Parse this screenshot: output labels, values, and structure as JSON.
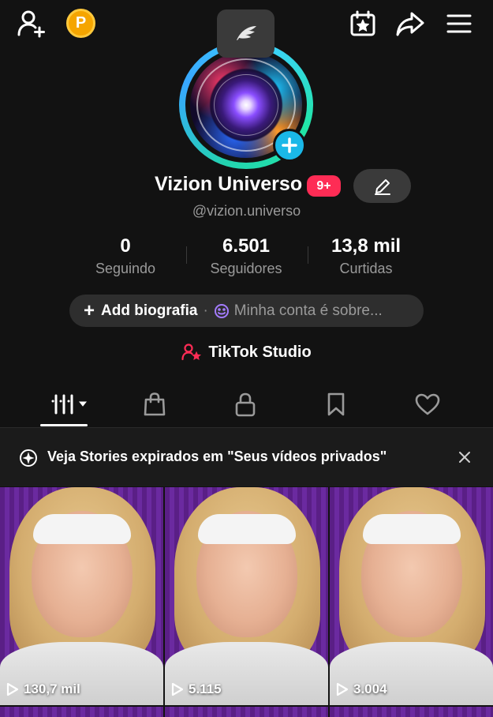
{
  "topbar": {
    "left_icons": [
      "add-friend-icon",
      "coin-icon"
    ],
    "coin_label": "P",
    "right_icons": [
      "calendar-star-icon",
      "share-icon",
      "menu-icon"
    ]
  },
  "profile": {
    "display_name": "Vizion Universo",
    "notification_badge": "9+",
    "username": "@vizion.universo",
    "avatar_theme": "zodiac-wheel"
  },
  "stats": [
    {
      "value": "0",
      "label": "Seguindo"
    },
    {
      "value": "6.501",
      "label": "Seguidores"
    },
    {
      "value": "13,8 mil",
      "label": "Curtidas"
    }
  ],
  "bio": {
    "add_label": "Add biografia",
    "separator": "·",
    "about_placeholder": "Minha conta é sobre..."
  },
  "studio": {
    "label": "TikTok Studio"
  },
  "tabs": [
    {
      "icon": "videos-grid-icon",
      "selected": true
    },
    {
      "icon": "shop-bag-icon",
      "selected": false
    },
    {
      "icon": "lock-icon",
      "selected": false
    },
    {
      "icon": "bookmark-icon",
      "selected": false
    },
    {
      "icon": "heart-icon",
      "selected": false
    }
  ],
  "banner": {
    "text": "Veja Stories expirados em \"Seus vídeos privados\""
  },
  "videos": [
    {
      "views": "130,7 mil"
    },
    {
      "views": "5.115"
    },
    {
      "views": "3.004"
    }
  ],
  "colors": {
    "background": "#121212",
    "accent_pink": "#fe2c55",
    "accent_cyan": "#1ab8e8",
    "coin": "#f5a500",
    "pill": "#2e2e2e"
  }
}
